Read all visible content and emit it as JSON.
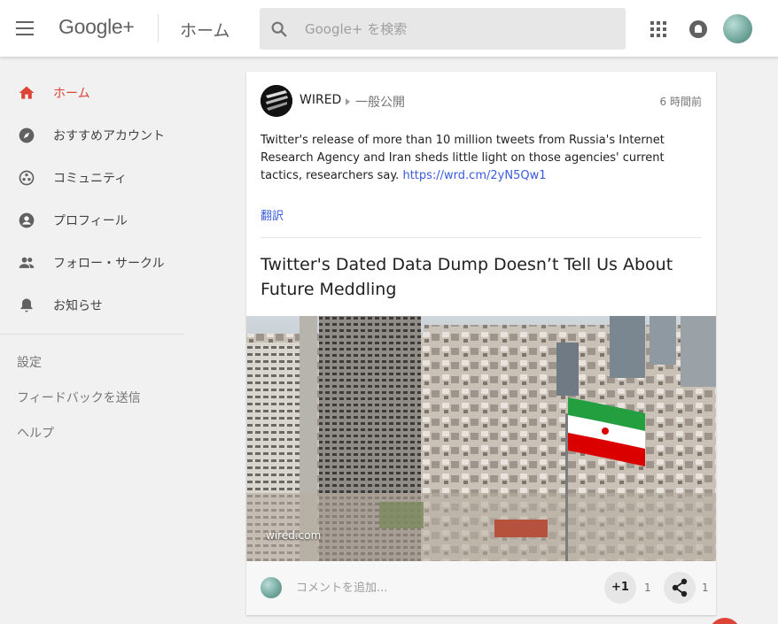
{
  "header": {
    "logo": "Google+",
    "page_title": "ホーム",
    "search_placeholder": "Google+ を検索"
  },
  "sidebar": {
    "items": [
      {
        "label": "ホーム",
        "icon": "home-icon",
        "active": true
      },
      {
        "label": "おすすめアカウント",
        "icon": "compass-icon"
      },
      {
        "label": "コミュニティ",
        "icon": "communities-icon"
      },
      {
        "label": "プロフィール",
        "icon": "profile-icon"
      },
      {
        "label": "フォロー・サークル",
        "icon": "people-icon"
      },
      {
        "label": "お知らせ",
        "icon": "bell-icon"
      }
    ],
    "links": [
      "設定",
      "フィードバックを送信",
      "ヘルプ"
    ]
  },
  "post": {
    "author": "WIRED",
    "visibility": "一般公開",
    "timestamp": "6 時間前",
    "text": "Twitter's release of more than 10 million tweets from Russia's Internet Research Agency and Iran sheds little light on those agencies' current tactics, researchers say.",
    "link": "https://wrd.cm/2yN5Qw1",
    "translate": "翻訳",
    "article_title": "Twitter's Dated Data Dump Doesn’t Tell Us About Future Meddling",
    "source": "wired.com",
    "comment_placeholder": "コメントを追加...",
    "plusone_label": "+1",
    "plusone_count": "1",
    "share_count": "1"
  },
  "colors": {
    "accent": "#db4437",
    "link": "#3b5bdb",
    "background": "#f1f1f1"
  }
}
